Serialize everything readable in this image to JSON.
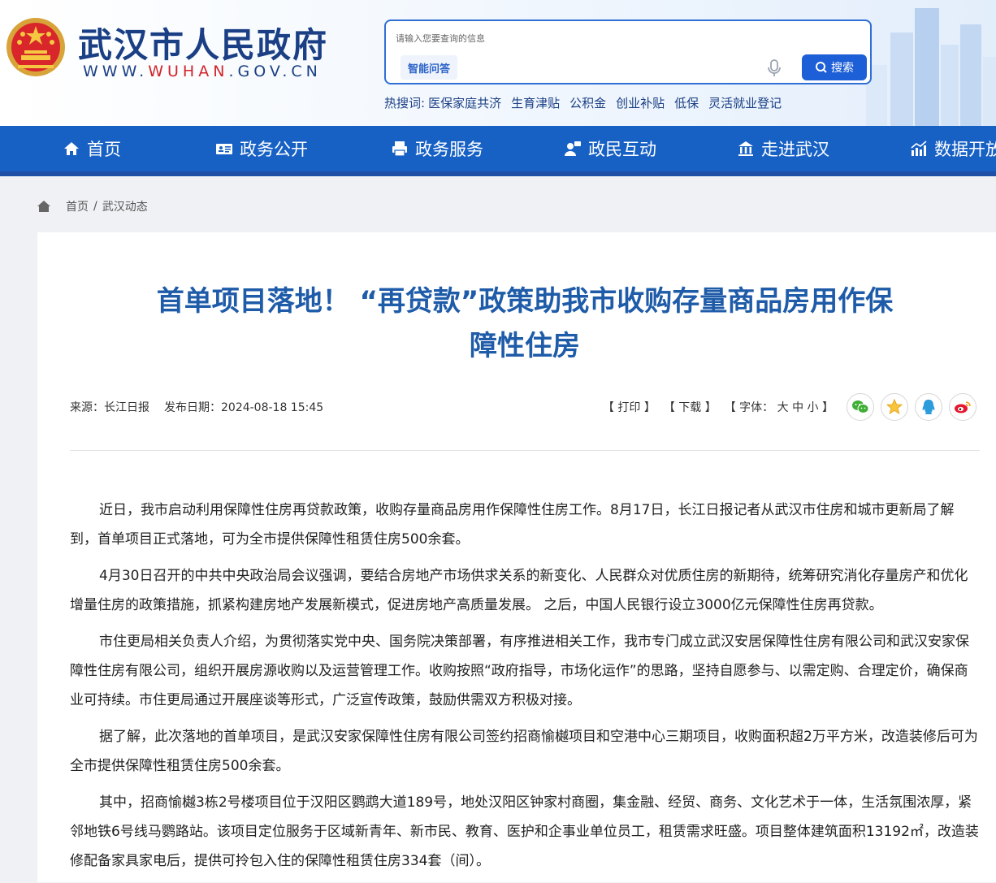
{
  "header": {
    "site_title": "武汉市人民政府",
    "url_prefix": "WWW.",
    "url_mid": "WUHAN",
    "url_suffix": ".GOV.CN",
    "search_placeholder": "请输入您要查询的信息",
    "ai_label": "智能问答",
    "search_button": "搜索",
    "hot_label": "热搜词:",
    "hot_words": [
      "医保家庭共济",
      "生育津贴",
      "公积金",
      "创业补贴",
      "低保",
      "灵活就业登记"
    ]
  },
  "nav": {
    "items": [
      {
        "label": "首页",
        "icon": "home-icon"
      },
      {
        "label": "政务公开",
        "icon": "id-card-icon"
      },
      {
        "label": "政务服务",
        "icon": "printer-icon"
      },
      {
        "label": "政民互动",
        "icon": "people-chat-icon"
      },
      {
        "label": "走进武汉",
        "icon": "building-icon"
      },
      {
        "label": "数据开放",
        "icon": "chart-icon"
      }
    ]
  },
  "breadcrumb": {
    "home": "首页",
    "sep": "/",
    "current": "武汉动态"
  },
  "article": {
    "title_line1": "首单项目落地！ “再贷款”政策助我市收购存量商品房用作保",
    "title_line2": "障性住房",
    "source": "来源：长江日报",
    "date": "发布日期：2024-08-18 15:45",
    "tools": {
      "print": "【 打印 】",
      "download": "【 下载 】",
      "font_open": "【 字体：",
      "font_large": "大",
      "font_medium": "中",
      "font_small": "小",
      "font_close": "】"
    },
    "share_icons": [
      "wechat-icon",
      "favorite-star-icon",
      "qq-icon",
      "weibo-icon"
    ],
    "paragraphs": [
      "近日，我市启动利用保障性住房再贷款政策，收购存量商品房用作保障性住房工作。8月17日，长江日报记者从武汉市住房和城市更新局了解到，首单项目正式落地，可为全市提供保障性租赁住房500余套。",
      "4月30日召开的中共中央政治局会议强调，要结合房地产市场供求关系的新变化、人民群众对优质住房的新期待，统筹研究消化存量房产和优化增量住房的政策措施，抓紧构建房地产发展新模式，促进房地产高质量发展。 之后，中国人民银行设立3000亿元保障性住房再贷款。",
      "市住更局相关负责人介绍，为贯彻落实党中央、国务院决策部署，有序推进相关工作，我市专门成立武汉安居保障性住房有限公司和武汉安家保障性住房有限公司，组织开展房源收购以及运营管理工作。收购按照“政府指导，市场化运作”的思路，坚持自愿参与、以需定购、合理定价，确保商业可持续。市住更局通过开展座谈等形式，广泛宣传政策，鼓励供需双方积极对接。",
      "据了解，此次落地的首单项目，是武汉安家保障性住房有限公司签约招商愉樾项目和空港中心三期项目，收购面积超2万平方米，改造装修后可为全市提供保障性租赁住房500余套。",
      "其中，招商愉樾3栋2号楼项目位于汉阳区鹦鹉大道189号，地处汉阳区钟家村商圈，集金融、经贸、商务、文化艺术于一体，生活氛围浓厚，紧邻地铁6号线马鹦路站。该项目定位服务于区域新青年、新市民、教育、医护和企事业单位员工，租赁需求旺盛。项目整体建筑面积13192㎡，改造装修配备家具家电后，提供可拎包入住的保障性租赁住房334套（间）。"
    ]
  },
  "colors": {
    "brand_blue": "#1761c5",
    "title_blue": "#1e5ba8",
    "url_red": "#d2242a"
  }
}
